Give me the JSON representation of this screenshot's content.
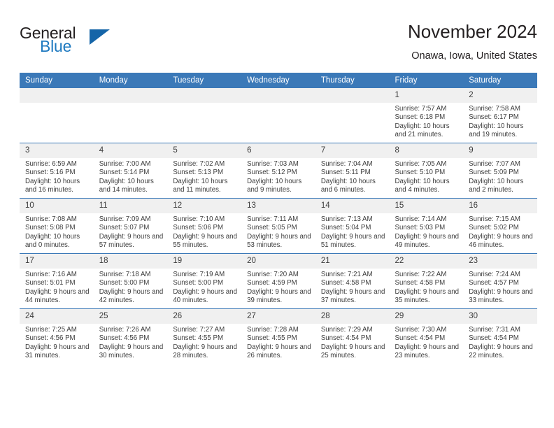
{
  "brand": {
    "name_part1": "General",
    "name_part2": "Blue",
    "triangle_color": "#1565a8",
    "blue_text_color": "#1f7ac0"
  },
  "header": {
    "title": "November 2024",
    "location": "Onawa, Iowa, United States"
  },
  "theme": {
    "header_blue": "#3b79b8",
    "daynum_band": "#f0f0f0",
    "text_color": "#3c3c3c"
  },
  "calendar": {
    "weekday_headers": [
      "Sunday",
      "Monday",
      "Tuesday",
      "Wednesday",
      "Thursday",
      "Friday",
      "Saturday"
    ],
    "labels": {
      "sunrise": "Sunrise:",
      "sunset": "Sunset:",
      "daylight": "Daylight:"
    },
    "weeks": [
      [
        {
          "day": "",
          "empty": true
        },
        {
          "day": "",
          "empty": true
        },
        {
          "day": "",
          "empty": true
        },
        {
          "day": "",
          "empty": true
        },
        {
          "day": "",
          "empty": true
        },
        {
          "day": "1",
          "sunrise": "Sunrise: 7:57 AM",
          "sunset": "Sunset: 6:18 PM",
          "daylight": "Daylight: 10 hours and 21 minutes."
        },
        {
          "day": "2",
          "sunrise": "Sunrise: 7:58 AM",
          "sunset": "Sunset: 6:17 PM",
          "daylight": "Daylight: 10 hours and 19 minutes."
        }
      ],
      [
        {
          "day": "3",
          "sunrise": "Sunrise: 6:59 AM",
          "sunset": "Sunset: 5:16 PM",
          "daylight": "Daylight: 10 hours and 16 minutes."
        },
        {
          "day": "4",
          "sunrise": "Sunrise: 7:00 AM",
          "sunset": "Sunset: 5:14 PM",
          "daylight": "Daylight: 10 hours and 14 minutes."
        },
        {
          "day": "5",
          "sunrise": "Sunrise: 7:02 AM",
          "sunset": "Sunset: 5:13 PM",
          "daylight": "Daylight: 10 hours and 11 minutes."
        },
        {
          "day": "6",
          "sunrise": "Sunrise: 7:03 AM",
          "sunset": "Sunset: 5:12 PM",
          "daylight": "Daylight: 10 hours and 9 minutes."
        },
        {
          "day": "7",
          "sunrise": "Sunrise: 7:04 AM",
          "sunset": "Sunset: 5:11 PM",
          "daylight": "Daylight: 10 hours and 6 minutes."
        },
        {
          "day": "8",
          "sunrise": "Sunrise: 7:05 AM",
          "sunset": "Sunset: 5:10 PM",
          "daylight": "Daylight: 10 hours and 4 minutes."
        },
        {
          "day": "9",
          "sunrise": "Sunrise: 7:07 AM",
          "sunset": "Sunset: 5:09 PM",
          "daylight": "Daylight: 10 hours and 2 minutes."
        }
      ],
      [
        {
          "day": "10",
          "sunrise": "Sunrise: 7:08 AM",
          "sunset": "Sunset: 5:08 PM",
          "daylight": "Daylight: 10 hours and 0 minutes."
        },
        {
          "day": "11",
          "sunrise": "Sunrise: 7:09 AM",
          "sunset": "Sunset: 5:07 PM",
          "daylight": "Daylight: 9 hours and 57 minutes."
        },
        {
          "day": "12",
          "sunrise": "Sunrise: 7:10 AM",
          "sunset": "Sunset: 5:06 PM",
          "daylight": "Daylight: 9 hours and 55 minutes."
        },
        {
          "day": "13",
          "sunrise": "Sunrise: 7:11 AM",
          "sunset": "Sunset: 5:05 PM",
          "daylight": "Daylight: 9 hours and 53 minutes."
        },
        {
          "day": "14",
          "sunrise": "Sunrise: 7:13 AM",
          "sunset": "Sunset: 5:04 PM",
          "daylight": "Daylight: 9 hours and 51 minutes."
        },
        {
          "day": "15",
          "sunrise": "Sunrise: 7:14 AM",
          "sunset": "Sunset: 5:03 PM",
          "daylight": "Daylight: 9 hours and 49 minutes."
        },
        {
          "day": "16",
          "sunrise": "Sunrise: 7:15 AM",
          "sunset": "Sunset: 5:02 PM",
          "daylight": "Daylight: 9 hours and 46 minutes."
        }
      ],
      [
        {
          "day": "17",
          "sunrise": "Sunrise: 7:16 AM",
          "sunset": "Sunset: 5:01 PM",
          "daylight": "Daylight: 9 hours and 44 minutes."
        },
        {
          "day": "18",
          "sunrise": "Sunrise: 7:18 AM",
          "sunset": "Sunset: 5:00 PM",
          "daylight": "Daylight: 9 hours and 42 minutes."
        },
        {
          "day": "19",
          "sunrise": "Sunrise: 7:19 AM",
          "sunset": "Sunset: 5:00 PM",
          "daylight": "Daylight: 9 hours and 40 minutes."
        },
        {
          "day": "20",
          "sunrise": "Sunrise: 7:20 AM",
          "sunset": "Sunset: 4:59 PM",
          "daylight": "Daylight: 9 hours and 39 minutes."
        },
        {
          "day": "21",
          "sunrise": "Sunrise: 7:21 AM",
          "sunset": "Sunset: 4:58 PM",
          "daylight": "Daylight: 9 hours and 37 minutes."
        },
        {
          "day": "22",
          "sunrise": "Sunrise: 7:22 AM",
          "sunset": "Sunset: 4:58 PM",
          "daylight": "Daylight: 9 hours and 35 minutes."
        },
        {
          "day": "23",
          "sunrise": "Sunrise: 7:24 AM",
          "sunset": "Sunset: 4:57 PM",
          "daylight": "Daylight: 9 hours and 33 minutes."
        }
      ],
      [
        {
          "day": "24",
          "sunrise": "Sunrise: 7:25 AM",
          "sunset": "Sunset: 4:56 PM",
          "daylight": "Daylight: 9 hours and 31 minutes."
        },
        {
          "day": "25",
          "sunrise": "Sunrise: 7:26 AM",
          "sunset": "Sunset: 4:56 PM",
          "daylight": "Daylight: 9 hours and 30 minutes."
        },
        {
          "day": "26",
          "sunrise": "Sunrise: 7:27 AM",
          "sunset": "Sunset: 4:55 PM",
          "daylight": "Daylight: 9 hours and 28 minutes."
        },
        {
          "day": "27",
          "sunrise": "Sunrise: 7:28 AM",
          "sunset": "Sunset: 4:55 PM",
          "daylight": "Daylight: 9 hours and 26 minutes."
        },
        {
          "day": "28",
          "sunrise": "Sunrise: 7:29 AM",
          "sunset": "Sunset: 4:54 PM",
          "daylight": "Daylight: 9 hours and 25 minutes."
        },
        {
          "day": "29",
          "sunrise": "Sunrise: 7:30 AM",
          "sunset": "Sunset: 4:54 PM",
          "daylight": "Daylight: 9 hours and 23 minutes."
        },
        {
          "day": "30",
          "sunrise": "Sunrise: 7:31 AM",
          "sunset": "Sunset: 4:54 PM",
          "daylight": "Daylight: 9 hours and 22 minutes."
        }
      ]
    ]
  }
}
